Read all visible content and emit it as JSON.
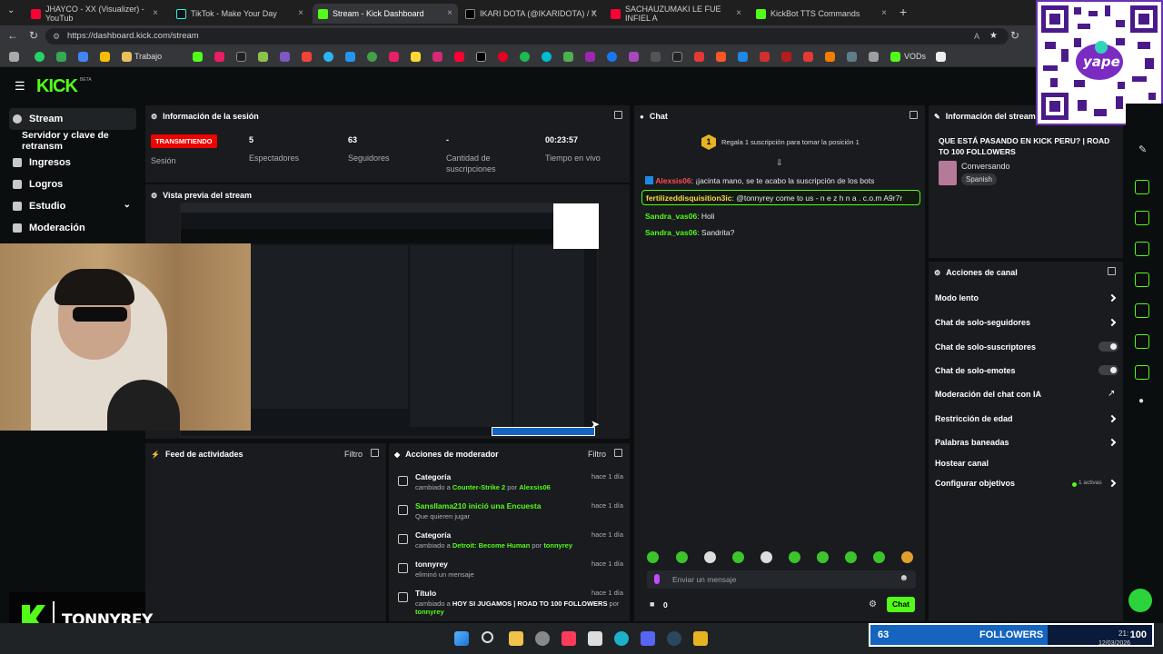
{
  "browser": {
    "tabs": [
      {
        "label": "JHAYCO - XX (Visualizer) - YouTub",
        "color": "#ff0033"
      },
      {
        "label": "TikTok - Make Your Day",
        "color": "#111111"
      },
      {
        "label": "Stream - Kick Dashboard",
        "color": "#53fc18"
      },
      {
        "label": "IKARI DOTA (@IKARIDOTA) / X",
        "color": "#000000"
      },
      {
        "label": "SACHAUZUMAKI LE FUE INFIEL A",
        "color": "#ff0033"
      },
      {
        "label": "KickBot TTS Commands",
        "color": "#53fc18"
      }
    ],
    "url": "https://dashboard.kick.com/stream",
    "bookmarks": {
      "trabajo": "Trabajo",
      "vods": "VODs"
    }
  },
  "kick": {
    "logo": "KICK",
    "beta": "BETA"
  },
  "sidebar": {
    "items": [
      {
        "label": "Stream"
      },
      {
        "label": "Servidor y clave de retransm"
      },
      {
        "label": "Ingresos"
      },
      {
        "label": "Logros"
      },
      {
        "label": "Estudio"
      },
      {
        "label": "Moderación"
      }
    ]
  },
  "session": {
    "title": "Información de la sesión",
    "badge": "TRANSMITIENDO",
    "badge_label": "Sesión",
    "stats": [
      {
        "value": "5",
        "label": "Espectadores"
      },
      {
        "value": "63",
        "label": "Seguidores"
      },
      {
        "value": "-",
        "label": "Cantidad de suscripciones"
      },
      {
        "value": "00:23:57",
        "label": "Tiempo en vivo"
      }
    ]
  },
  "preview": {
    "title": "Vista previa del stream"
  },
  "activity": {
    "title": "Feed de actividades",
    "filter": "Filtro"
  },
  "mod_actions": {
    "title": "Acciones de moderador",
    "filter": "Filtro",
    "rows": [
      {
        "title": "Categoría",
        "pre": "cambiado a ",
        "g1": "Counter-Strike 2",
        "mid": " por ",
        "g2": "Alexsis06",
        "time": "hace 1 día"
      },
      {
        "title": "Sansllama210 inició una Encuesta",
        "pre": "Que quieren jugar",
        "g1": "",
        "mid": "",
        "g2": "",
        "time": "hace 1 día"
      },
      {
        "title": "Categoría",
        "pre": "cambiado a ",
        "g1": "Detroit: Become Human",
        "mid": " por ",
        "g2": "tonnyrey",
        "time": "hace 1 día"
      },
      {
        "title": "tonnyrey",
        "pre": "eliminó un mensaje",
        "g1": "",
        "mid": "",
        "g2": "",
        "time": "hace 1 día"
      },
      {
        "title": "Título",
        "pre": "cambiado a ",
        "g1": "",
        "mid": "HOY SI JUGAMOS | ROAD TO 100 FOLLOWERS",
        "g2": " por",
        "time": "hace 1 día",
        "line2": "tonnyrey"
      }
    ]
  },
  "chat": {
    "title": "Chat",
    "pinned_rank": "1",
    "pinned": "Regala 1 suscripción para tomar la posición 1",
    "messages": [
      {
        "user": "Alexsis06",
        "color": "#ff4d4d",
        "text": "¡jacinta mano, se te acabo la suscripción de los bots"
      },
      {
        "user": "fertilizeddisquisition3ic",
        "color": "#ffd84a",
        "text": "@tonnyrey come to us - n e z h n a . c.o.m A9r7r"
      },
      {
        "user": "Sandra_vas06",
        "color": "#53fc18",
        "text": "Holi"
      },
      {
        "user": "Sandra_vas06",
        "color": "#53fc18",
        "text": "Sandrita?"
      }
    ],
    "input_placeholder": "Enviar un mensaje",
    "points": "0",
    "send": "Chat"
  },
  "stream_info": {
    "title": "Información del stream",
    "stream_title": "QUE ESTÁ PASANDO EN KICK PERU? | ROAD TO 100 FOLLOWERS",
    "category": "Conversando",
    "language": "Spanish"
  },
  "channel_actions": {
    "title": "Acciones de canal",
    "items": [
      {
        "label": "Modo lento",
        "control": "chevron"
      },
      {
        "label": "Chat de solo-seguidores",
        "control": "chevron"
      },
      {
        "label": "Chat de solo-suscriptores",
        "control": "toggle"
      },
      {
        "label": "Chat de solo-emotes",
        "control": "toggle"
      },
      {
        "label": "Moderación del chat con IA",
        "control": "external"
      },
      {
        "label": "Restricción de edad",
        "control": "chevron"
      },
      {
        "label": "Palabras baneadas",
        "control": "chevron"
      },
      {
        "label": "Hostear canal",
        "control": "none"
      },
      {
        "label": "Configurar objetivos",
        "control": "chevron"
      }
    ],
    "goals_active": "1 activas"
  },
  "overlay": {
    "streamer": "TONNYREY",
    "qr_brand": "yape",
    "followers_count": "63",
    "followers_label": "FOLLOWERS",
    "followers_goal": "100"
  },
  "taskbar": {
    "time": "21:",
    "date": "12/03/2026"
  }
}
